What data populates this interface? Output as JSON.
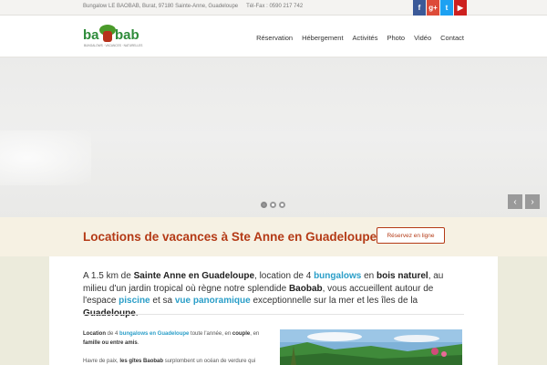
{
  "topbar": {
    "address": "Bungalow LE BAOBAB, Burat, 97180 Sainte-Anne, Guadeloupe",
    "phone": "Tél-Fax : 0590 217 742",
    "social": [
      {
        "icon": "f",
        "name": "facebook-icon",
        "color": "#3b5998"
      },
      {
        "icon": "g+",
        "name": "google-plus-icon",
        "color": "#dd4b39"
      },
      {
        "icon": "t",
        "name": "twitter-icon",
        "color": "#1da1f2"
      },
      {
        "icon": "▶",
        "name": "youtube-icon",
        "color": "#cd201f"
      }
    ]
  },
  "logo": {
    "text": "baObab",
    "tagline": "BUNGALOWS · VACANCES · NATURELLES"
  },
  "nav": [
    "Réservation",
    "Hébergement",
    "Activités",
    "Photo",
    "Vidéo",
    "Contact"
  ],
  "slider": {
    "prev": "‹",
    "next": "›"
  },
  "cta": {
    "title": "Locations de vacances à Ste Anne en Guadeloupe !",
    "button": "Réservez en ligne"
  },
  "lead": {
    "t1": "A 1.5 km de ",
    "b1": "Sainte Anne en Guadeloupe",
    "t2": ", location de 4 ",
    "h1": "bungalows",
    "t3": " en ",
    "b2": "bois naturel",
    "t4": ", au milieu d'un jardin tropical où règne notre splendide ",
    "b3": "Baobab",
    "t5": ", vous accueillent autour de l'espace ",
    "h2": "piscine",
    "t6": " et sa ",
    "h3": "vue panoramique",
    "t7": " exceptionnelle sur la mer et les îles de la ",
    "b4": "Guadeloupe",
    "t8": "."
  },
  "col": {
    "p1a": "Location",
    "p1b": " de 4 ",
    "p1c": "bungalows en Guadeloupe",
    "p1d": " toute l'année, en ",
    "p1e": "couple",
    "p1f": ", en ",
    "p1g": "famille ou entre amis",
    "p1h": ".",
    "p2a": "Havre de paix, ",
    "p2b": " les gîtes Baobab",
    "p2c": " surplombent un océan de verdure qui"
  },
  "colors": {
    "accent": "#b43a16",
    "link": "#2a9ec8"
  }
}
